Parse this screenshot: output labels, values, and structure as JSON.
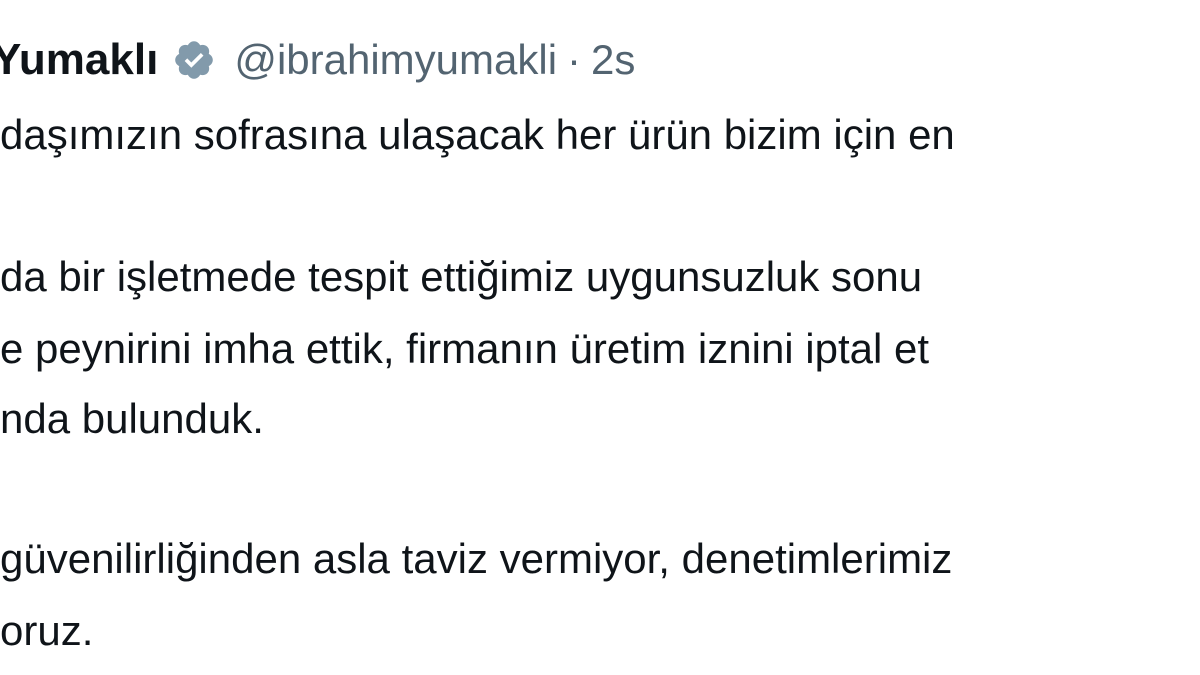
{
  "top_partial_text": "‿ ‿ ‿ ‿ ‿ ‿ ‿ ‿ ‿",
  "tweet": {
    "author_name": "Yumaklı",
    "verified_icon": "verified-badge-icon",
    "handle": "@ibrahimyumakli",
    "separator": "·",
    "time": "2s",
    "lines": [
      "daşımızın sofrasına ulaşacak her ürün bizim için en",
      "da bir işletmede tespit ettiğimiz uygunsuzluk sonu",
      "e peynirini imha ettik, firmanın üretim iznini iptal et",
      "nda bulunduk.",
      "güvenilirliğinden asla taviz vermiyor, denetimlerimiz",
      "oruz."
    ]
  },
  "colors": {
    "text": "#0f1419",
    "secondary": "#536471",
    "badge": "#829aab"
  }
}
